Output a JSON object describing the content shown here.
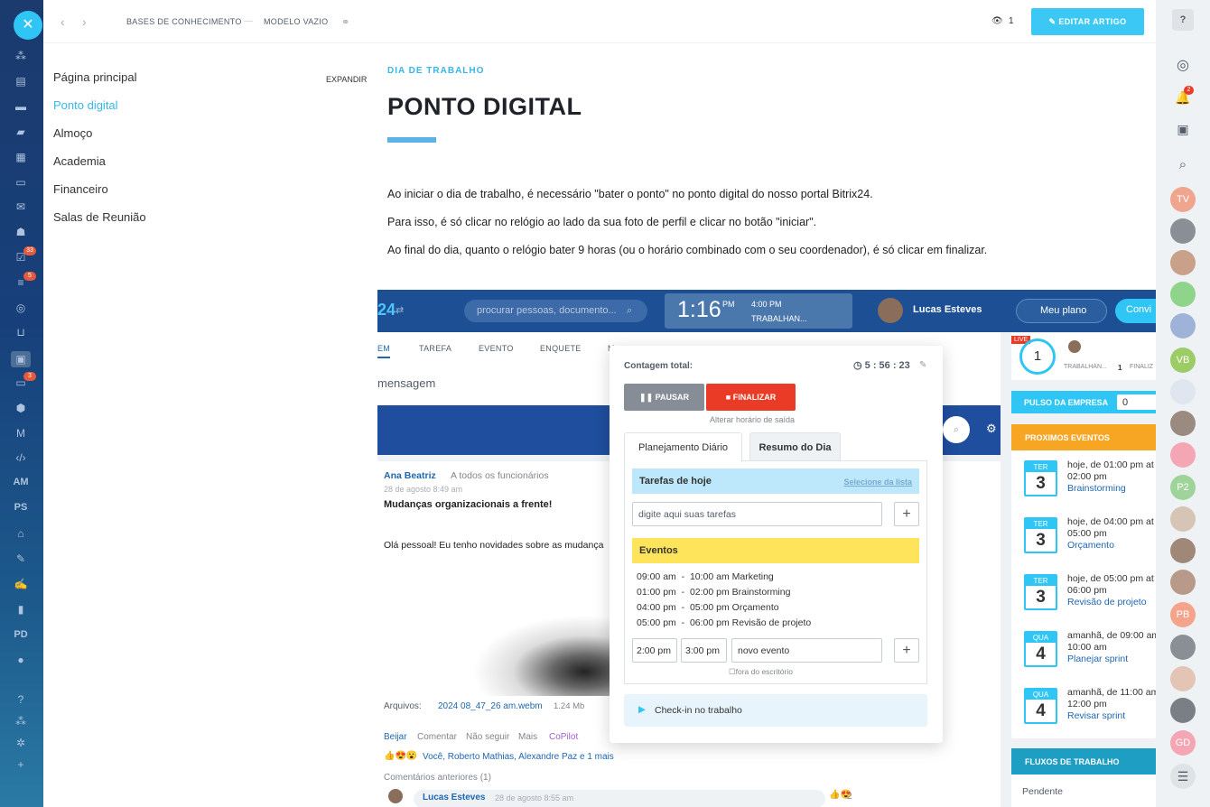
{
  "topbar": {
    "crumb1": "BASES DE CONHECIMENTO",
    "crumb_sep": "—",
    "crumb2": "MODELO VAZIO",
    "views": "1",
    "edit_label": "EDITAR ARTIGO"
  },
  "leftbar": {
    "labels": [
      "AM",
      "PS",
      "PD"
    ],
    "badge1": "33",
    "badge2": "5",
    "badge3": "3"
  },
  "menu": {
    "expand": "EXPANDIR",
    "items": [
      "Página principal",
      "Ponto digital",
      "Almoço",
      "Academia",
      "Financeiro",
      "Salas de Reunião"
    ]
  },
  "article": {
    "section": "DIA DE TRABALHO",
    "title": "PONTO DIGITAL",
    "p1": "Ao iniciar o dia de trabalho, é necessário \"bater o ponto\" no ponto digital do nosso portal Bitrix24.",
    "p2": "Para isso, é só clicar no relógio ao lado da sua foto de perfil e clicar no botão \"iniciar\".",
    "p3": "Ao final do dia, quanto o relógio bater 9 horas (ou o horário combinado com o seu coordenador), é só clicar em finalizar."
  },
  "screenshot": {
    "logo": "24",
    "search_placeholder": "procurar pessoas, documento...",
    "clock": "1:16",
    "clock_pm": "PM",
    "clock_end": "4:00 PM",
    "clock_status": "TRABALHAN...",
    "user": "Lucas Esteves",
    "plan": "Meu plano",
    "invite": "Convi",
    "feed_tabs": [
      "EM",
      "TAREFA",
      "EVENTO",
      "ENQUETE",
      "M"
    ],
    "feed_input": "mensagem",
    "post_author": "Ana Beatriz",
    "post_to": "A todos os funcionários",
    "post_date": "28 de agosto 8:49 am",
    "post_title": "Mudanças organizacionais a frente!",
    "post_body": "Olá pessoal! Eu tenho novidades sobre as mudança",
    "files_label": "Arquivos:",
    "file_name": "2024 08_47_26 am.webm",
    "file_size": "1.24 Mb",
    "actions": [
      "Beijar",
      "Comentar",
      "Não seguir",
      "Mais",
      "CoPilot"
    ],
    "reactions": "Você, Roberto Mathias, Alexandre Paz e 1 mais",
    "prev_comments": "Comentários anteriores (1)",
    "comment_author": "Lucas Esteves",
    "comment_date": "28 de agosto 8:55 am",
    "comment_count": "2",
    "popup": {
      "total_label": "Contagem total:",
      "total": "5 : 56 : 23",
      "pause": "PAUSAR",
      "finish": "FINALIZAR",
      "alter": "Alterar horário de saída",
      "tab1": "Planejamento Diário",
      "tab2": "Resumo do Dia",
      "tasks_title": "Tarefas de hoje",
      "tasks_select": "Selecione da lista",
      "tasks_placeholder": "digite aqui suas tarefas",
      "events_title": "Eventos",
      "events": [
        {
          "time": "09:00 am  -  10:00 am",
          "name": "Marketing"
        },
        {
          "time": "01:00 pm  -  02:00 pm",
          "name": "Brainstorming"
        },
        {
          "time": "04:00 pm  -  05:00 pm",
          "name": "Orçamento"
        },
        {
          "time": "05:00 pm  -  06:00 pm",
          "name": "Revisão de projeto"
        }
      ],
      "from": "2:00 pm",
      "to": "3:00 pm",
      "new_event": "novo evento",
      "out_office": "fora do escritório",
      "checkin": "Check-in no trabalho"
    },
    "live": "LIVE",
    "live_count": "1",
    "working": "TRABALHAN...",
    "working_n": "1",
    "finished": "FINALIZ",
    "pulse": "PULSO DA EMPRESA",
    "pulse_val": "0",
    "upcoming": "PROXIMOS EVENTOS",
    "cards": [
      {
        "day": "TER",
        "num": "3",
        "line1": "hoje, de 01:00 pm at",
        "line2": "02:00 pm",
        "name": "Brainstorming"
      },
      {
        "day": "TER",
        "num": "3",
        "line1": "hoje, de 04:00 pm at",
        "line2": "05:00 pm",
        "name": "Orçamento"
      },
      {
        "day": "TER",
        "num": "3",
        "line1": "hoje, de 05:00 pm at",
        "line2": "06:00 pm",
        "name": "Revisão de projeto"
      },
      {
        "day": "QUA",
        "num": "4",
        "line1": "amanhã, de 09:00 am",
        "line2": "10:00 am",
        "name": "Planejar sprint"
      },
      {
        "day": "QUA",
        "num": "4",
        "line1": "amanhã, de 11:00 am",
        "line2": "12:00 pm",
        "name": "Revisar sprint"
      }
    ],
    "workflows": "FLUXOS DE TRABALHO",
    "pending": "Pendente"
  },
  "rightbar": {
    "bell_badge": "2",
    "avatars": [
      "TV",
      "VB",
      "P2",
      "PB",
      "GD"
    ]
  }
}
